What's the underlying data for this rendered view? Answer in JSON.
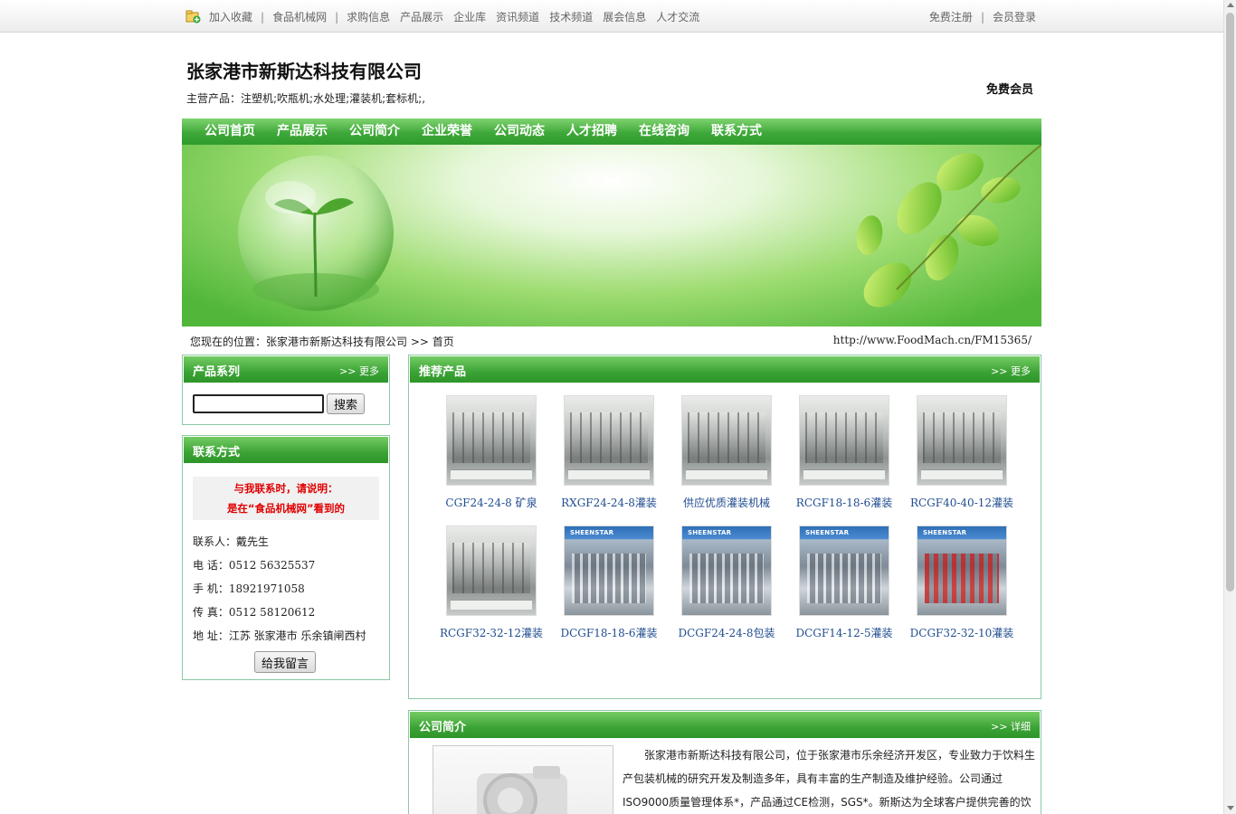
{
  "topbar": {
    "left_links": [
      "加入收藏",
      "食品机械网",
      "求购信息",
      "产品展示",
      "企业库",
      "资讯频道",
      "技术频道",
      "展会信息",
      "人才交流"
    ],
    "right_links": [
      "免费注册",
      "会员登录"
    ]
  },
  "header": {
    "company_name": "张家港市新斯达科技有限公司",
    "main_products": "主营产品：注塑机;吹瓶机;水处理;灌装机;套标机;,",
    "member_level": "免费会员"
  },
  "nav": {
    "items": [
      "公司首页",
      "产品展示",
      "公司简介",
      "企业荣誉",
      "公司动态",
      "人才招聘",
      "在线咨询",
      "联系方式"
    ]
  },
  "breadcrumb": {
    "text": "您现在的位置：张家港市新斯达科技有限公司 >> 首页",
    "url": "http://www.FoodMach.cn/FM15365/"
  },
  "product_series": {
    "title": "产品系列",
    "more": ">> 更多",
    "search_button": "搜索"
  },
  "contact": {
    "title": "联系方式",
    "notice_line1": "与我联系时，请说明：",
    "notice_line2": "是在“食品机械网”看到的",
    "person_label": "联系人：",
    "person": "戴先生",
    "phone_label": "电 话：",
    "phone": "0512 56325537",
    "mobile_label": "手 机：",
    "mobile": "18921971058",
    "fax_label": "传 真：",
    "fax": "0512 58120612",
    "address_label": "地 址：",
    "address": "江苏 张家港市 乐余镇闸西村",
    "message_button": "给我留言"
  },
  "recommended": {
    "title": "推荐产品",
    "more": ">> 更多",
    "products": [
      {
        "name": "CGF24-24-8 矿泉",
        "style": "machine"
      },
      {
        "name": "RXGF24-24-8灌装",
        "style": "machine"
      },
      {
        "name": "供应优质灌装机械",
        "style": "machine"
      },
      {
        "name": "RCGF18-18-6灌装",
        "style": "machine"
      },
      {
        "name": "RCGF40-40-12灌装",
        "style": "machine"
      },
      {
        "name": "RCGF32-32-12灌装",
        "style": "machine"
      },
      {
        "name": "DCGF18-18-6灌装",
        "style": "sheen"
      },
      {
        "name": "DCGF24-24-8包装",
        "style": "sheen"
      },
      {
        "name": "DCGF14-12-5灌装",
        "style": "sheen"
      },
      {
        "name": "DCGF32-32-10灌装",
        "style": "sheen-red"
      }
    ],
    "thumb_brand": "SHEENSTAR"
  },
  "intro": {
    "title": "公司简介",
    "more": ">> 详细",
    "text": "张家港市新斯达科技有限公司，位于张家港市乐余经济开发区，专业致力于饮料生产包装机械的研究开发及制造多年，具有丰富的生产制造及维护经验。公司通过ISO9000质量管理体系*，产品通过CE检测，SGS*。新斯达为全球客户提供完善的饮"
  },
  "colors": {
    "nav_green": "#3fa83a",
    "panel_border": "#8cc9a6",
    "link_blue": "#1f4c8f",
    "notice_red": "#e00000"
  }
}
